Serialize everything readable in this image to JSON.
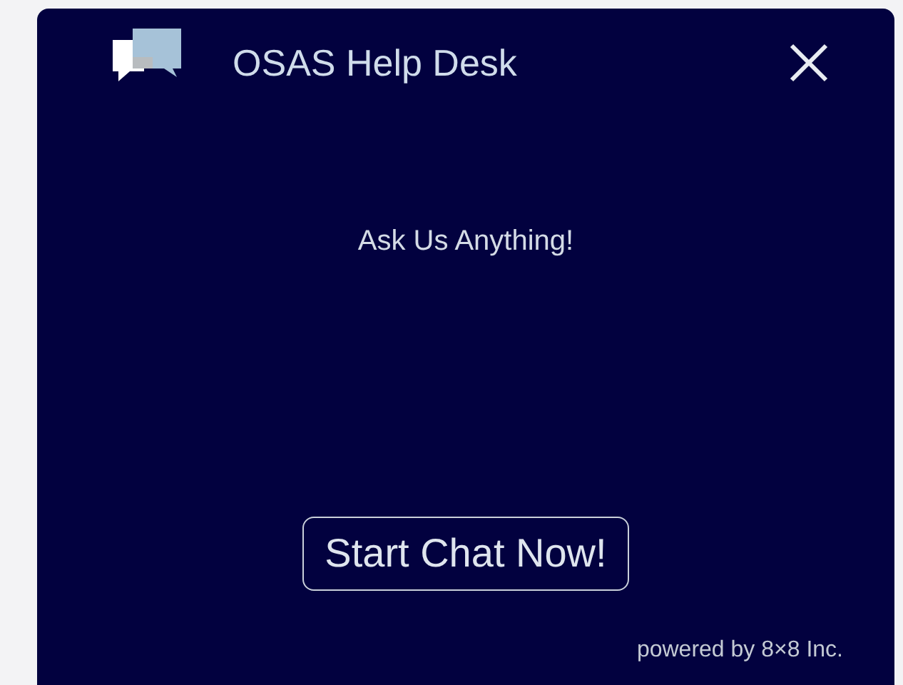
{
  "header": {
    "title": "OSAS Help Desk"
  },
  "prompt": "Ask Us Anything!",
  "start_button": "Start Chat Now!",
  "footer": "powered by 8×8 Inc."
}
